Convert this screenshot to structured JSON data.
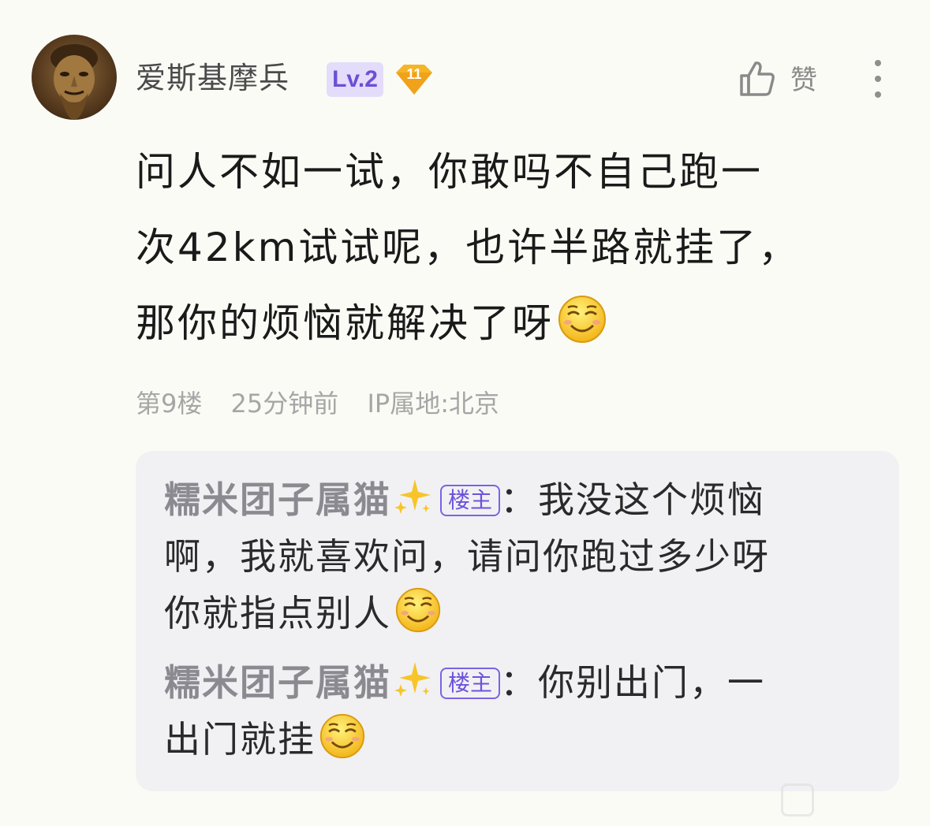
{
  "post": {
    "user": {
      "name": "爱斯基摩兵",
      "level_badge": "Lv.2",
      "fan_badge_number": "11"
    },
    "like": {
      "label": "赞"
    },
    "comment_text": [
      "问人不如一试，你敢吗不自己跑一",
      "次42km试试呢，也许半路就挂了，",
      "那你的烦恼就解决了呀"
    ],
    "meta": {
      "floor": "第9楼",
      "time": "25分钟前",
      "ip_location": "IP属地:北京"
    }
  },
  "replies": [
    {
      "author": "糯米团子属猫",
      "tag": "楼主",
      "separator": "：",
      "text_lines": [
        "我没这个烦恼",
        "啊，我就喜欢问，请问你跑过多少呀",
        "你就指点别人"
      ]
    },
    {
      "author": "糯米团子属猫",
      "tag": "楼主",
      "separator": "：",
      "text_lines": [
        "你别出门，一",
        "出门就挂"
      ]
    }
  ],
  "colors": {
    "background": "#fbfbf6",
    "level_badge_bg": "#e4dcfb",
    "level_badge_text": "#6d4fd6",
    "fan_badge": "#f5b526",
    "host_tag": "#7b63e6",
    "reply_box_bg": "#f1f1f4"
  },
  "icons": [
    "avatar-image",
    "fan-badge-icon",
    "thumbs-up-icon",
    "more-options-icon",
    "grin-emoji-icon",
    "sparkles-icon"
  ]
}
